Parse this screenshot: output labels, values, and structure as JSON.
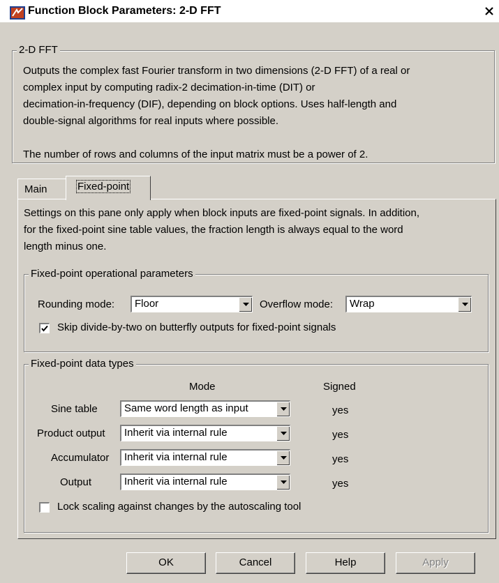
{
  "window": {
    "title": "Function Block Parameters: 2-D FFT",
    "close_icon": "close-icon"
  },
  "block": {
    "group_label": "2-D FFT",
    "description_lines": [
      "Outputs the complex fast Fourier transform in two dimensions (2-D FFT) of a real or",
      "complex input by computing radix-2 decimation-in-time (DIT) or",
      "decimation-in-frequency (DIF), depending on block options. Uses half-length and",
      "double-signal algorithms for real inputs where possible."
    ],
    "note": "The number of rows and columns of the input matrix must be a power of 2."
  },
  "tabs": [
    {
      "label": "Main",
      "active": false
    },
    {
      "label": "Fixed-point",
      "active": true
    }
  ],
  "fixed_point": {
    "intro_lines": [
      "Settings on this pane only apply when block inputs are fixed-point signals. In addition,",
      "for the fixed-point sine table values, the fraction length is always equal to the word",
      "length minus one."
    ],
    "operational": {
      "group_label": "Fixed-point operational parameters",
      "rounding_label": "Rounding mode:",
      "rounding_value": "Floor",
      "overflow_label": "Overflow mode:",
      "overflow_value": "Wrap",
      "skip_label": "Skip divide-by-two on butterfly outputs for fixed-point signals",
      "skip_checked": true
    },
    "data_types": {
      "group_label": "Fixed-point data types",
      "col_mode": "Mode",
      "col_signed": "Signed",
      "rows": [
        {
          "label": "Sine table",
          "mode": "Same word length as input",
          "signed": "yes"
        },
        {
          "label": "Product output",
          "mode": "Inherit via internal rule",
          "signed": "yes"
        },
        {
          "label": "Accumulator",
          "mode": "Inherit via internal rule",
          "signed": "yes"
        },
        {
          "label": "Output",
          "mode": "Inherit via internal rule",
          "signed": "yes"
        }
      ],
      "lock_label": "Lock scaling against changes by the autoscaling tool",
      "lock_checked": false
    }
  },
  "buttons": {
    "ok": "OK",
    "cancel": "Cancel",
    "help": "Help",
    "apply": "Apply"
  }
}
